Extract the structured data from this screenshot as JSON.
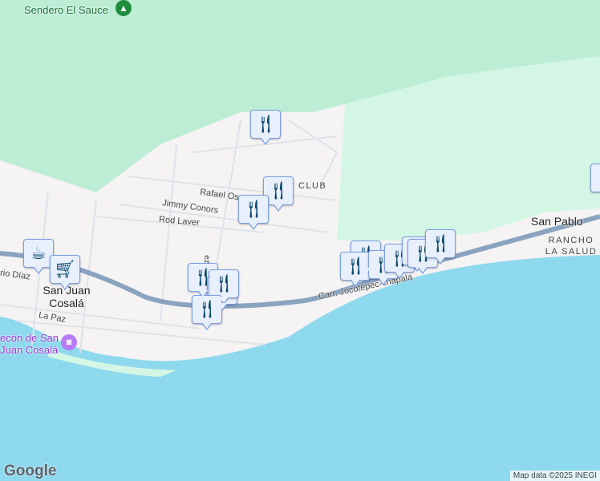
{
  "colors": {
    "water": "#8fd9ee",
    "forest": "#bdeed5",
    "greenery": "#d3f7e4",
    "land": "#f5f3f3",
    "highway": "#8aa4bf",
    "marker_fill": "#e8efff",
    "marker_icon": "#0d4a6e",
    "poi": "#9334e6"
  },
  "labels": {
    "trail": "Sendero El Sauce",
    "town1": "San Juan Cosalá",
    "town2": "San Pablo",
    "neighborhood": "RANCHO LA SALUD",
    "club": "CLUB",
    "street1": "Rafael Os",
    "street2": "Jimmy Conors",
    "street3": "Rod Laver",
    "street4": "La Paz",
    "street5": "rio Díaz",
    "street6": "ez",
    "highway": "Carr. Jocotepec-chapala",
    "poi": "ecón de San Juan Cosalá"
  },
  "markers": [
    {
      "type": "restaurant",
      "icon": "fork-knife-icon"
    },
    {
      "type": "restaurant",
      "icon": "fork-knife-icon"
    },
    {
      "type": "restaurant",
      "icon": "fork-knife-icon"
    },
    {
      "type": "restaurant",
      "icon": "fork-knife-icon"
    },
    {
      "type": "restaurant",
      "icon": "fork-knife-icon"
    },
    {
      "type": "cafe",
      "icon": "coffee-cup-icon"
    },
    {
      "type": "restaurant",
      "icon": "fork-knife-icon"
    },
    {
      "type": "cafe",
      "icon": "coffee-cup-icon"
    },
    {
      "type": "shopping",
      "icon": "shopping-cart-icon"
    },
    {
      "type": "restaurant",
      "icon": "fork-knife-icon"
    },
    {
      "type": "restaurant",
      "icon": "fork-knife-icon"
    },
    {
      "type": "restaurant",
      "icon": "fork-knife-icon"
    },
    {
      "type": "restaurant",
      "icon": "fork-knife-icon"
    },
    {
      "type": "restaurant",
      "icon": "fork-knife-icon"
    },
    {
      "type": "restaurant",
      "icon": "fork-knife-icon"
    },
    {
      "type": "restaurant",
      "icon": "fork-knife-icon"
    },
    {
      "type": "restaurant",
      "icon": "fork-knife-icon"
    }
  ],
  "branding": {
    "logo": "Google",
    "attribution": "Map data ©2025 INEGI"
  }
}
